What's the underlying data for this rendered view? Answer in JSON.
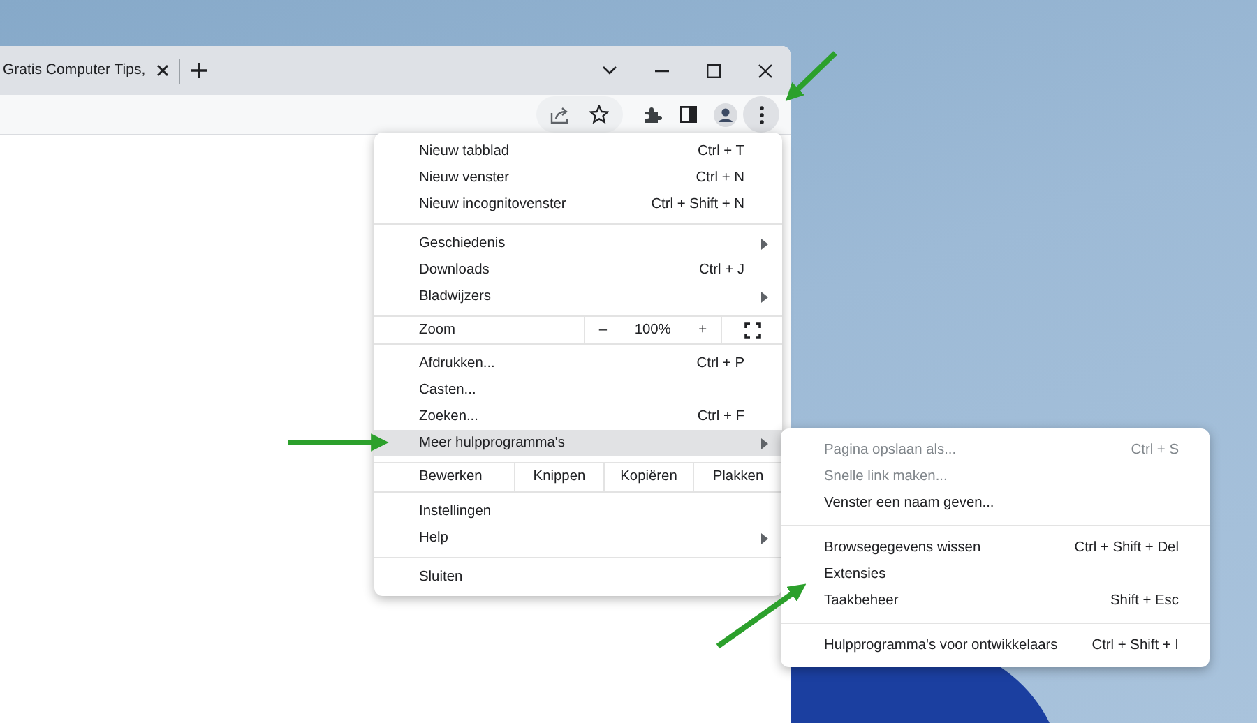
{
  "browser": {
    "tab": {
      "title": "Gratis Computer Tips,"
    }
  },
  "menu": {
    "sections": [
      {
        "kind": "list",
        "items": [
          {
            "label": "Nieuw tabblad",
            "shortcut": "Ctrl + T",
            "submenu": false,
            "selected": false
          },
          {
            "label": "Nieuw venster",
            "shortcut": "Ctrl + N",
            "submenu": false,
            "selected": false
          },
          {
            "label": "Nieuw incognitovenster",
            "shortcut": "Ctrl + Shift + N",
            "submenu": false,
            "selected": false
          }
        ]
      },
      {
        "kind": "list",
        "items": [
          {
            "label": "Geschiedenis",
            "submenu": true,
            "selected": false
          },
          {
            "label": "Downloads",
            "shortcut": "Ctrl + J",
            "submenu": false,
            "selected": false
          },
          {
            "label": "Bladwijzers",
            "submenu": true,
            "selected": false
          }
        ]
      },
      {
        "kind": "zoom",
        "label": "Zoom",
        "minus": "–",
        "value": "100%",
        "plus": "+"
      },
      {
        "kind": "list",
        "items": [
          {
            "label": "Afdrukken...",
            "shortcut": "Ctrl + P",
            "submenu": false,
            "selected": false
          },
          {
            "label": "Casten...",
            "submenu": false,
            "selected": false
          },
          {
            "label": "Zoeken...",
            "shortcut": "Ctrl + F",
            "submenu": false,
            "selected": false
          },
          {
            "label": "Meer hulpprogramma's",
            "submenu": true,
            "selected": true
          }
        ]
      },
      {
        "kind": "edit",
        "label": "Bewerken",
        "actions": [
          "Knippen",
          "Kopiëren",
          "Plakken"
        ]
      },
      {
        "kind": "list",
        "items": [
          {
            "label": "Instellingen",
            "submenu": false,
            "selected": false
          },
          {
            "label": "Help",
            "submenu": true,
            "selected": false
          }
        ]
      },
      {
        "kind": "list",
        "items": [
          {
            "label": "Sluiten",
            "submenu": false,
            "selected": false
          }
        ]
      }
    ]
  },
  "submenu": {
    "sections": [
      [
        {
          "label": "Pagina opslaan als...",
          "shortcut": "Ctrl + S",
          "disabled": true
        },
        {
          "label": "Snelle link maken...",
          "disabled": true
        },
        {
          "label": "Venster een naam geven...",
          "disabled": false
        }
      ],
      [
        {
          "label": "Browsegegevens wissen",
          "shortcut": "Ctrl + Shift + Del",
          "disabled": false
        },
        {
          "label": "Extensies",
          "disabled": false
        },
        {
          "label": "Taakbeheer",
          "shortcut": "Shift + Esc",
          "disabled": false
        }
      ],
      [
        {
          "label": "Hulpprogramma's voor ontwikkelaars",
          "shortcut": "Ctrl + Shift + I",
          "disabled": false
        }
      ]
    ]
  }
}
